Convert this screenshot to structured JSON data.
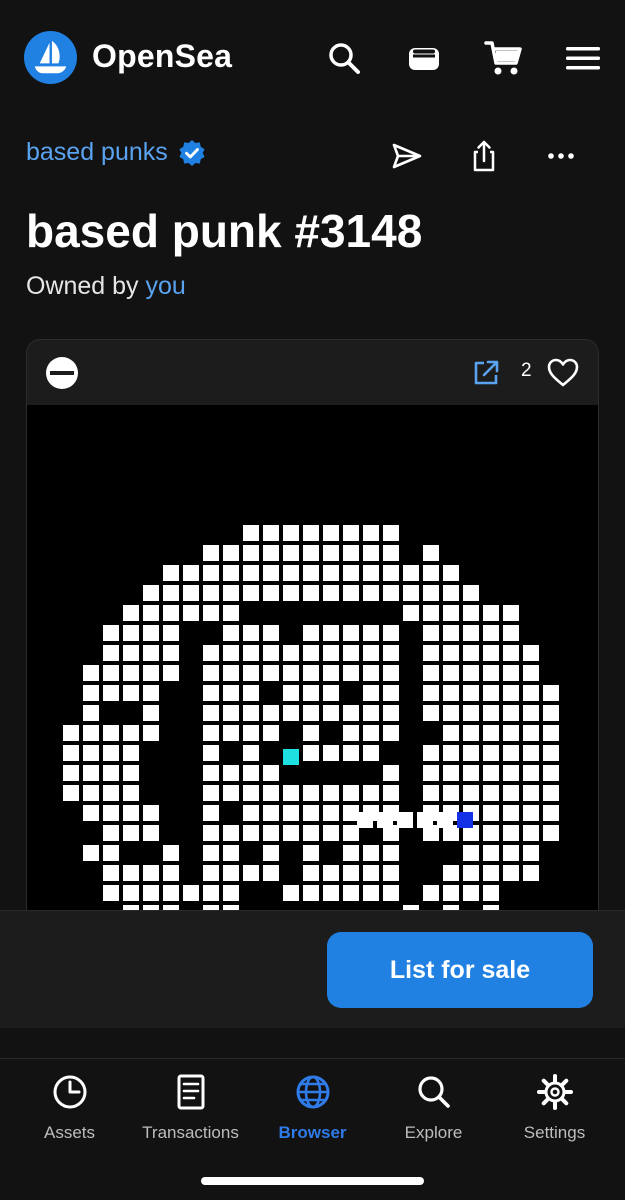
{
  "header": {
    "brand": "OpenSea",
    "icons": [
      "search-icon",
      "wallet-icon",
      "cart-icon",
      "menu-icon"
    ]
  },
  "item": {
    "collection": "based punks",
    "title": "based punk #3148",
    "owned_prefix": "Owned by",
    "owner": "you",
    "favorites": "2",
    "actions": [
      "send-icon",
      "share-icon",
      "more-icon"
    ]
  },
  "action_bar": {
    "list_label": "List for sale"
  },
  "tabs": [
    {
      "label": "Assets",
      "icon": "clock-icon",
      "active": false
    },
    {
      "label": "Transactions",
      "icon": "document-icon",
      "active": false
    },
    {
      "label": "Browser",
      "icon": "globe-icon",
      "active": true
    },
    {
      "label": "Explore",
      "icon": "search-icon",
      "active": false
    },
    {
      "label": "Settings",
      "icon": "gear-icon",
      "active": false
    }
  ],
  "colors": {
    "background": "#121212",
    "accent_blue": "#2081e2",
    "link_blue": "#5aa3f0",
    "active_tab": "#2f7be8",
    "pixel_white": "#ffffff",
    "pixel_cyan": "#1fe0e0",
    "pixel_blue": "#1430e6"
  }
}
